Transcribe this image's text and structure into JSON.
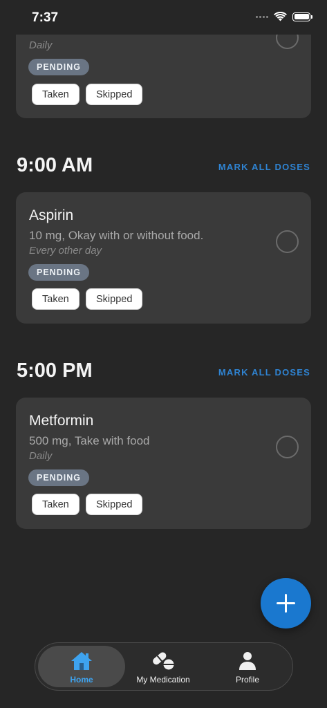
{
  "status_bar": {
    "time": "7:37"
  },
  "top_card": {
    "frequency": "Daily",
    "status": "PENDING",
    "taken_label": "Taken",
    "skipped_label": "Skipped"
  },
  "sections": [
    {
      "time": "9:00 AM",
      "mark_all_label": "MARK ALL DOSES",
      "medication": {
        "name": "Aspirin",
        "dose": "10 mg, Okay with or without food.",
        "frequency": "Every other day",
        "status": "PENDING",
        "taken_label": "Taken",
        "skipped_label": "Skipped"
      }
    },
    {
      "time": "5:00 PM",
      "mark_all_label": "MARK ALL DOSES",
      "medication": {
        "name": "Metformin",
        "dose": "500 mg, Take with food",
        "frequency": "Daily",
        "status": "PENDING",
        "taken_label": "Taken",
        "skipped_label": "Skipped"
      }
    }
  ],
  "fab": {
    "icon": "plus-icon"
  },
  "tabs": [
    {
      "label": "Home",
      "icon": "home-icon",
      "active": true
    },
    {
      "label": "My Medication",
      "icon": "pills-icon",
      "active": false
    },
    {
      "label": "Profile",
      "icon": "person-icon",
      "active": false
    }
  ],
  "colors": {
    "background": "#262626",
    "card": "#3a3a3a",
    "accent": "#1a78cf",
    "badge": "#6a7584",
    "active_tab": "#3ea3ef"
  }
}
